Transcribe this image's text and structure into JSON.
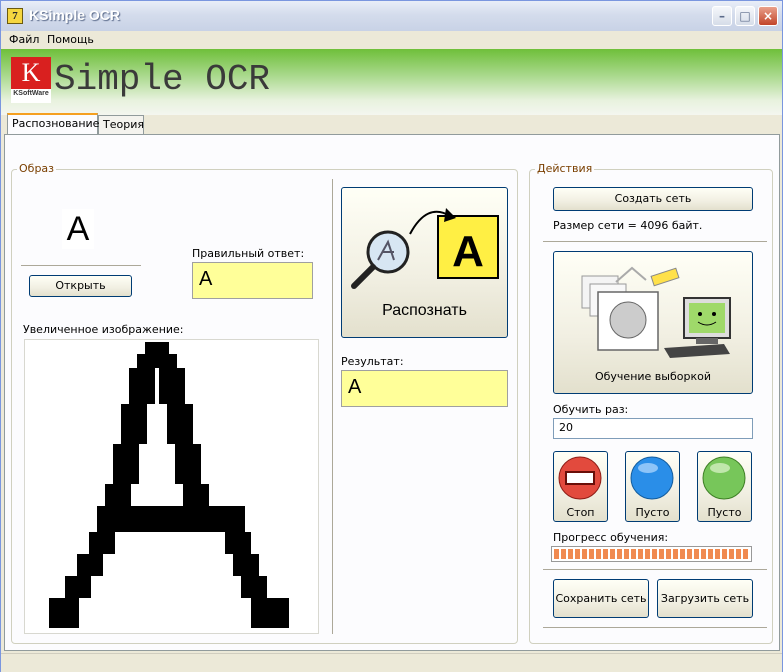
{
  "window": {
    "title": "KSimple OCR",
    "minimize": "–",
    "maximize": "□",
    "close": "×"
  },
  "menu": {
    "items": [
      "Файл",
      "Помощь"
    ]
  },
  "banner": {
    "logo_letter": "K",
    "logo_text": "KSoftWare",
    "title": "Simple OCR"
  },
  "tabs": [
    "Распознование",
    "Теория"
  ],
  "image_group": {
    "title": "Образ",
    "sample_char": "A",
    "open_button": "Открыть",
    "correct_answer_label": "Правильный ответ:",
    "correct_answer_value": "A",
    "zoomed_label": "Увеличенное изображение:"
  },
  "recognize": {
    "button_label": "Распознать",
    "result_label": "Результат:",
    "result_value": "A"
  },
  "actions": {
    "title": "Действия",
    "create_network": "Создать сеть",
    "network_size": "Размер сети = 4096 байт.",
    "train_sample": "Обучение выборкой",
    "train_count_label": "Обучить раз:",
    "train_count_value": "20",
    "stop": "Стоп",
    "empty1": "Пусто",
    "empty2": "Пусто",
    "progress_label": "Прогресс обучения:",
    "progress_fraction": 1.0,
    "save_network": "Сохранить сеть",
    "load_network": "Загрузить сеть"
  },
  "colors": {
    "stop": "#e24a3d",
    "empty1": "#2a8ee8",
    "empty2": "#77c65a",
    "banner": "#6fbf3a",
    "logo": "#d9201f"
  }
}
